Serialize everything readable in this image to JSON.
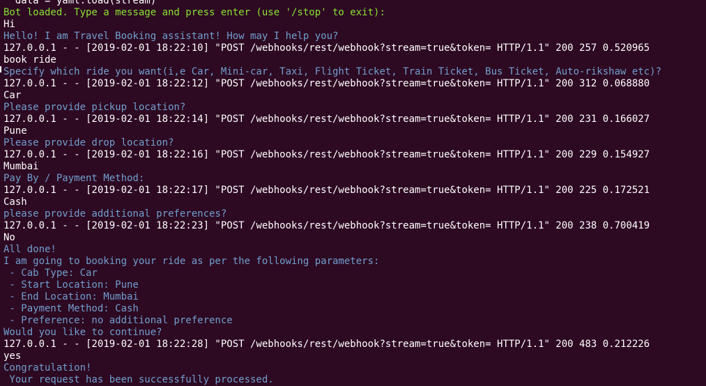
{
  "terminal": {
    "lines": [
      {
        "text": "  data = yaml.load(stream)",
        "color": "white"
      },
      {
        "text": "Bot loaded. Type a message and press enter (use '/stop' to exit):",
        "color": "green"
      },
      {
        "text": "Hi",
        "color": "white"
      },
      {
        "text": "Hello! I am Travel Booking assistant! How may I help you?",
        "color": "blue"
      },
      {
        "text": "127.0.0.1 - - [2019-02-01 18:22:10] \"POST /webhooks/rest/webhook?stream=true&token= HTTP/1.1\" 200 257 0.520965",
        "color": "white"
      },
      {
        "text": "book ride",
        "color": "white"
      },
      {
        "text": "Specify which ride you want(i,e Car, Mini-car, Taxi, Flight Ticket, Train Ticket, Bus Ticket, Auto-rikshaw etc)?",
        "color": "blue"
      },
      {
        "text": "127.0.0.1 - - [2019-02-01 18:22:12] \"POST /webhooks/rest/webhook?stream=true&token= HTTP/1.1\" 200 312 0.068880",
        "color": "white"
      },
      {
        "text": "Car",
        "color": "white"
      },
      {
        "text": "Please provide pickup location?",
        "color": "blue"
      },
      {
        "text": "127.0.0.1 - - [2019-02-01 18:22:14] \"POST /webhooks/rest/webhook?stream=true&token= HTTP/1.1\" 200 231 0.166027",
        "color": "white"
      },
      {
        "text": "Pune",
        "color": "white"
      },
      {
        "text": "Please provide drop location?",
        "color": "blue"
      },
      {
        "text": "127.0.0.1 - - [2019-02-01 18:22:16] \"POST /webhooks/rest/webhook?stream=true&token= HTTP/1.1\" 200 229 0.154927",
        "color": "white"
      },
      {
        "text": "Mumbai",
        "color": "white"
      },
      {
        "text": "Pay By / Payment Method:",
        "color": "blue"
      },
      {
        "text": "127.0.0.1 - - [2019-02-01 18:22:17] \"POST /webhooks/rest/webhook?stream=true&token= HTTP/1.1\" 200 225 0.172521",
        "color": "white"
      },
      {
        "text": "Cash",
        "color": "white"
      },
      {
        "text": "please provide additional preferences?",
        "color": "blue"
      },
      {
        "text": "127.0.0.1 - - [2019-02-01 18:22:23] \"POST /webhooks/rest/webhook?stream=true&token= HTTP/1.1\" 200 238 0.700419",
        "color": "white"
      },
      {
        "text": "No",
        "color": "white"
      },
      {
        "text": "All done!",
        "color": "blue"
      },
      {
        "text": "I am going to booking your ride as per the following parameters:",
        "color": "blue"
      },
      {
        "text": " - Cab Type: Car",
        "color": "blue"
      },
      {
        "text": " - Start Location: Pune",
        "color": "blue"
      },
      {
        "text": " - End Location: Mumbai",
        "color": "blue"
      },
      {
        "text": " - Payment Method: Cash",
        "color": "blue"
      },
      {
        "text": " - Preference: no additional preference",
        "color": "blue"
      },
      {
        "text": "Would you like to continue?",
        "color": "blue"
      },
      {
        "text": "127.0.0.1 - - [2019-02-01 18:22:28] \"POST /webhooks/rest/webhook?stream=true&token= HTTP/1.1\" 200 483 0.212226",
        "color": "white"
      },
      {
        "text": "yes",
        "color": "white"
      },
      {
        "text": "Congratulation!",
        "color": "blue"
      },
      {
        "text": " Your request has been successfully processed.",
        "color": "blue"
      }
    ]
  },
  "colors": {
    "background": "#2d0922",
    "green": "#8ae234",
    "blue": "#729fcf",
    "white": "#ffffff"
  }
}
